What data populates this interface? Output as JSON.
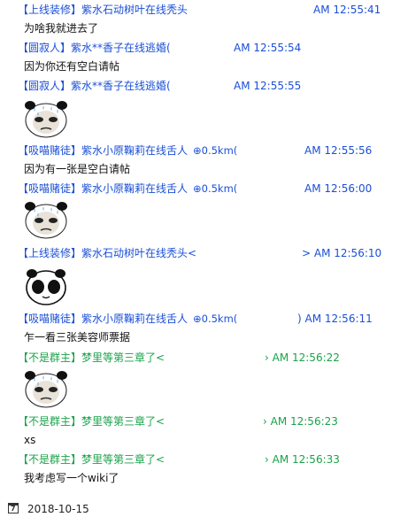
{
  "colors": {
    "blue": "#1a4fd6",
    "green": "#1aa24a"
  },
  "messages": [
    {
      "sender": "【上线装修】紫水石动树叶在线秃头",
      "distance": "",
      "time": "AM 12:55:41",
      "color": "blue",
      "text": "为啥我就进去了",
      "sticker": ""
    },
    {
      "sender": "【圆寂人】紫水**香子在线逃婚(",
      "distance": "",
      "time": "AM 12:55:54",
      "color": "blue",
      "text": "因为你还有空白请帖",
      "sticker": ""
    },
    {
      "sender": "【圆寂人】紫水**香子在线逃婚(",
      "distance": "",
      "time": "AM 12:55:55",
      "color": "blue",
      "text": "",
      "sticker": "panda-crying-face"
    },
    {
      "sender": "【吸喵赌徒】紫水小原鞠莉在线舌人",
      "distance": "⊕0.5km(",
      "time": "AM 12:55:56",
      "color": "blue",
      "text": "因为有一张是空白请帖",
      "sticker": ""
    },
    {
      "sender": "【吸喵赌徒】紫水小原鞠莉在线舌人",
      "distance": "⊕0.5km(",
      "time": "AM 12:56:00",
      "color": "blue",
      "text": "",
      "sticker": "panda-crying-face"
    },
    {
      "sender": "【上线装修】紫水石动树叶在线秃头<",
      "distance": "",
      "time": "> AM 12:56:10",
      "color": "blue",
      "text": "",
      "sticker": "panda-sunglasses-face"
    },
    {
      "sender": "【吸喵赌徒】紫水小原鞠莉在线舌人",
      "distance": "⊕0.5km(",
      "time": ") AM 12:56:11",
      "color": "blue",
      "text": "乍一看三张美容师票据",
      "sticker": ""
    },
    {
      "sender": "【不是群主】梦里等第三章了<",
      "distance": "",
      "time": "› AM 12:56:22",
      "color": "green",
      "text": "",
      "sticker": "panda-crying-face"
    },
    {
      "sender": "【不是群主】梦里等第三章了<",
      "distance": "",
      "time": "› AM 12:56:23",
      "color": "green",
      "text": "xs",
      "sticker": ""
    },
    {
      "sender": "【不是群主】梦里等第三章了<",
      "distance": "",
      "time": "› AM 12:56:33",
      "color": "green",
      "text": "我考虑写一个wiki了",
      "sticker": ""
    }
  ],
  "date_bar": {
    "icon": "calendar-icon",
    "icon_number": "7",
    "date": "2018-10-15"
  }
}
